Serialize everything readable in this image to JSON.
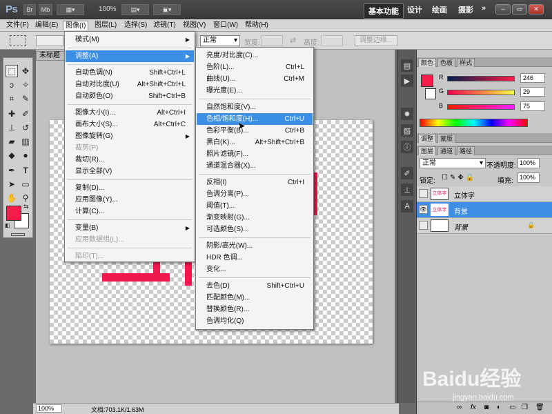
{
  "titlebar": {
    "logo": "Ps",
    "btn_br": "Br",
    "btn_mb": "Mb",
    "zoom": "100%",
    "workspaces": [
      "基本功能",
      "设计",
      "绘画",
      "摄影",
      "»"
    ]
  },
  "menubar": [
    "文件(F)",
    "编辑(E)",
    "图像(I)",
    "图层(L)",
    "选择(S)",
    "滤镜(T)",
    "视图(V)",
    "窗口(W)",
    "帮助(H)"
  ],
  "options": {
    "mode": "正常",
    "width_label": "宽度:",
    "height_label": "高度:",
    "refine_edge": "调整边缘..."
  },
  "document": {
    "tab": "未标题",
    "zoom": "100%",
    "doc_info": "文档:703.1K/1.63M"
  },
  "image_menu": [
    {
      "label": "模式(M)",
      "submenu": true
    },
    {
      "sep": true
    },
    {
      "label": "调整(A)",
      "submenu": true,
      "highlight": true
    },
    {
      "sep": true
    },
    {
      "label": "自动色调(N)",
      "shortcut": "Shift+Ctrl+L"
    },
    {
      "label": "自动对比度(U)",
      "shortcut": "Alt+Shift+Ctrl+L"
    },
    {
      "label": "自动颜色(O)",
      "shortcut": "Shift+Ctrl+B"
    },
    {
      "sep": true
    },
    {
      "label": "图像大小(I)...",
      "shortcut": "Alt+Ctrl+I"
    },
    {
      "label": "画布大小(S)...",
      "shortcut": "Alt+Ctrl+C"
    },
    {
      "label": "图像旋转(G)",
      "submenu": true
    },
    {
      "label": "裁剪(P)",
      "disabled": true
    },
    {
      "label": "裁切(R)..."
    },
    {
      "label": "显示全部(V)"
    },
    {
      "sep": true
    },
    {
      "label": "复制(D)..."
    },
    {
      "label": "应用图像(Y)..."
    },
    {
      "label": "计算(C)..."
    },
    {
      "sep": true
    },
    {
      "label": "变量(B)",
      "submenu": true
    },
    {
      "label": "应用数据组(L)...",
      "disabled": true
    },
    {
      "sep": true
    },
    {
      "label": "陷印(T)...",
      "disabled": true
    }
  ],
  "adjust_menu": [
    {
      "label": "亮度/对比度(C)..."
    },
    {
      "label": "色阶(L)...",
      "shortcut": "Ctrl+L"
    },
    {
      "label": "曲线(U)...",
      "shortcut": "Ctrl+M"
    },
    {
      "label": "曝光度(E)..."
    },
    {
      "sep": true
    },
    {
      "label": "自然饱和度(V)..."
    },
    {
      "label": "色相/饱和度(H)...",
      "shortcut": "Ctrl+U",
      "highlight": true
    },
    {
      "label": "色彩平衡(B)...",
      "shortcut": "Ctrl+B"
    },
    {
      "label": "黑白(K)...",
      "shortcut": "Alt+Shift+Ctrl+B"
    },
    {
      "label": "照片滤镜(F)..."
    },
    {
      "label": "通道混合器(X)..."
    },
    {
      "sep": true
    },
    {
      "label": "反相(I)",
      "shortcut": "Ctrl+I"
    },
    {
      "label": "色调分离(P)..."
    },
    {
      "label": "阈值(T)..."
    },
    {
      "label": "渐变映射(G)..."
    },
    {
      "label": "可选颜色(S)..."
    },
    {
      "sep": true
    },
    {
      "label": "阴影/高光(W)..."
    },
    {
      "label": "HDR 色调..."
    },
    {
      "label": "变化..."
    },
    {
      "sep": true
    },
    {
      "label": "去色(D)",
      "shortcut": "Shift+Ctrl+U"
    },
    {
      "label": "匹配颜色(M)..."
    },
    {
      "label": "替换颜色(R)..."
    },
    {
      "label": "色调均化(Q)"
    }
  ],
  "color_panel": {
    "tabs": [
      "颜色",
      "色板",
      "样式"
    ],
    "r_label": "R",
    "r": "246",
    "g_label": "G",
    "g": "29",
    "b_label": "B",
    "b": "75",
    "accent": "#f61d4b"
  },
  "adjust_panel": {
    "tabs": [
      "调整",
      "蒙版"
    ]
  },
  "layers_panel": {
    "tabs": [
      "图层",
      "通道",
      "路径"
    ],
    "blend_mode": "正常",
    "opacity_label": "不透明度:",
    "opacity": "100%",
    "lock_label": "锁定:",
    "fill_label": "填充:",
    "fill": "100%",
    "layers": [
      {
        "name": "立体字",
        "thumb": "立体字",
        "selected": false
      },
      {
        "name": "背景",
        "thumb": "立体字",
        "selected": true
      },
      {
        "name": "背景",
        "thumb": "",
        "selected": false,
        "locked": true
      }
    ],
    "footer_icons": [
      "link-icon",
      "fx-icon",
      "mask-icon",
      "adjustment-icon",
      "folder-icon",
      "new-layer-icon",
      "trash-icon"
    ]
  },
  "watermark": {
    "main": "Baidu经验",
    "sub": "jingyan.baidu.com"
  }
}
